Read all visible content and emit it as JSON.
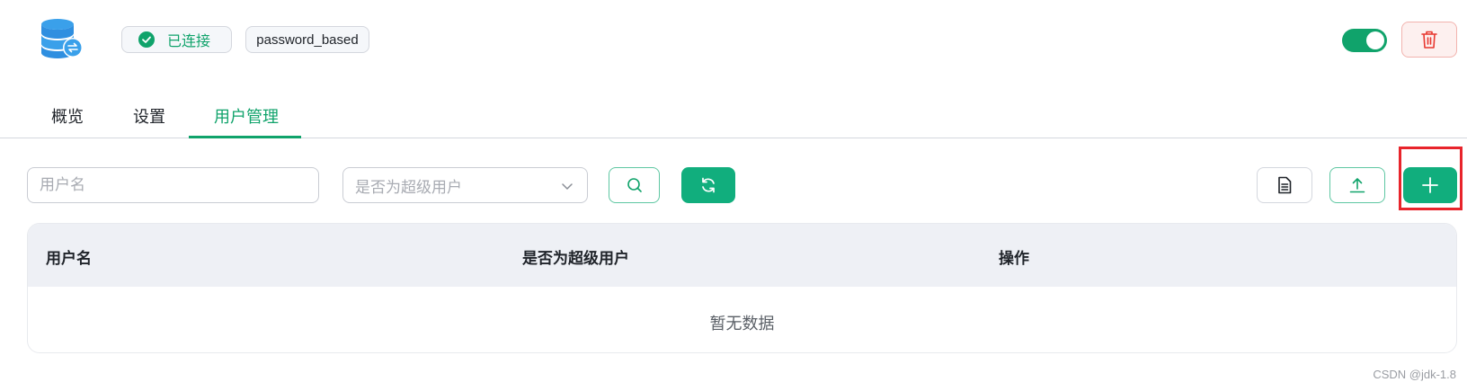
{
  "header": {
    "status": "已连接",
    "auth_type": "password_based",
    "enabled": true,
    "icons": {
      "logo": "database-sync-icon",
      "status": "check-circle-icon",
      "delete": "trash-icon"
    }
  },
  "tabs": [
    {
      "label": "概览",
      "active": false
    },
    {
      "label": "设置",
      "active": false
    },
    {
      "label": "用户管理",
      "active": true
    }
  ],
  "filters": {
    "username_placeholder": "用户名",
    "superuser_placeholder": "是否为超级用户",
    "icons": {
      "search": "search-icon",
      "refresh": "refresh-icon",
      "doc": "document-icon",
      "upload": "upload-icon",
      "add": "plus-icon"
    }
  },
  "table": {
    "columns": [
      "用户名",
      "是否为超级用户",
      "操作"
    ],
    "rows": [],
    "empty_text": "暂无数据"
  },
  "watermark": "CSDN @jdk-1.8",
  "colors": {
    "accent": "#10a36b",
    "primary_button": "#11ae7d",
    "danger": "#e8372f",
    "highlight": "#e8242b"
  }
}
